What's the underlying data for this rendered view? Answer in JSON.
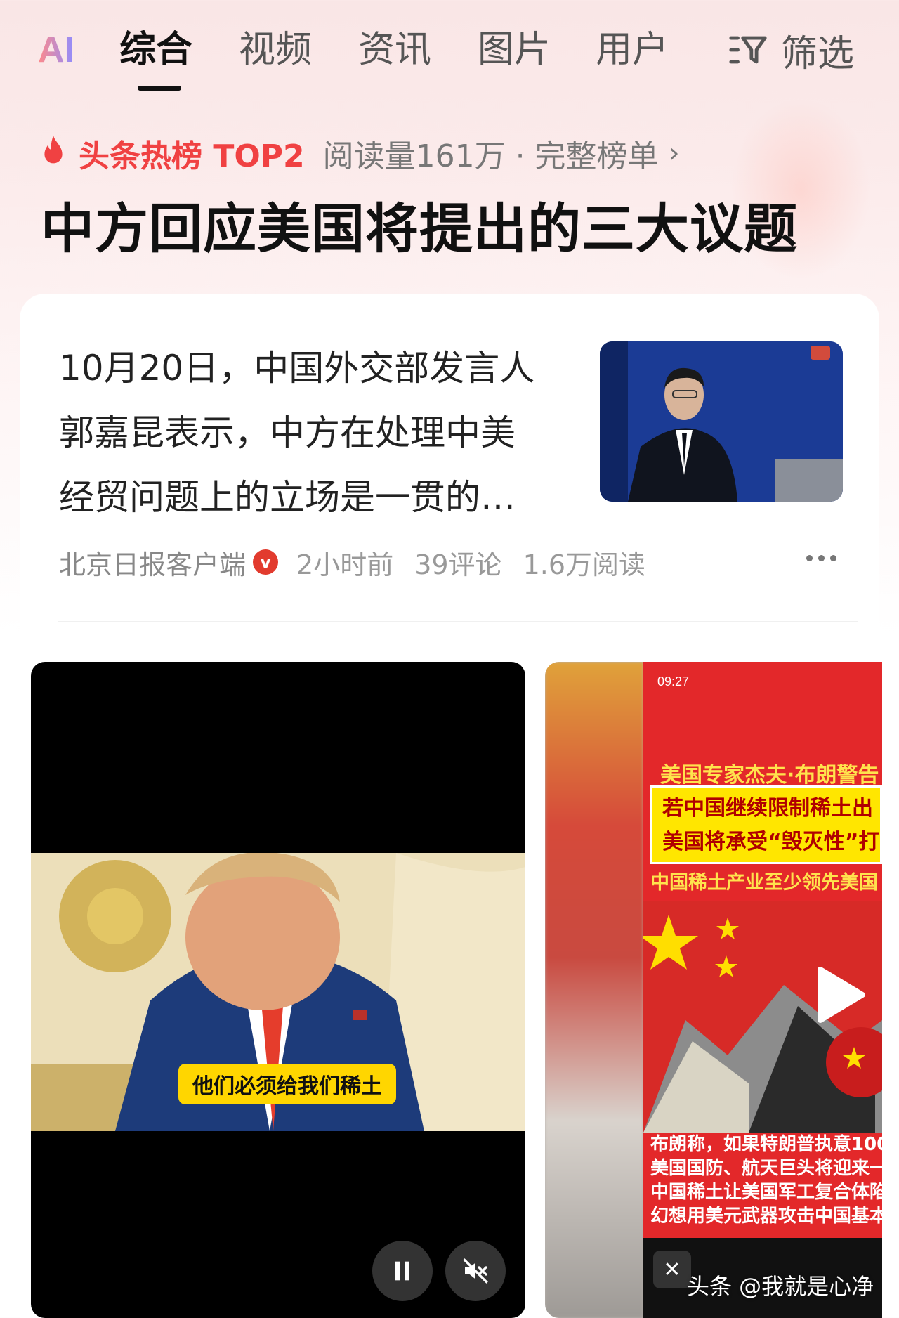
{
  "tabs": {
    "ai": "AI",
    "items": [
      {
        "label": "综合"
      },
      {
        "label": "视频"
      },
      {
        "label": "资讯"
      },
      {
        "label": "图片"
      },
      {
        "label": "用户"
      }
    ],
    "filter": "筛选"
  },
  "hot": {
    "brand": "头条热榜 TOP2",
    "meta": "阅读量161万 · 完整榜单",
    "chevron": "›"
  },
  "headline": "中方回应美国将提出的三大议题",
  "article": {
    "lines": [
      "10月20日，中国外交部发言人",
      "郭嘉昆表示，中方在处理中美",
      "经贸问题上的立场是一贯的…"
    ],
    "source": "北京日报客户端",
    "verified": "v",
    "time": "2小时前",
    "comments": "39评论",
    "reads": "1.6万阅读"
  },
  "video1": {
    "caption": "他们必须给我们稀土"
  },
  "video2": {
    "status_time": "09:27",
    "title1": "美国专家杰夫·布朗警告",
    "box_line1": "若中国继续限制稀土出",
    "box_line2": "美国将承受“毁灭性”打",
    "title2": "中国稀土产业至少领先美国",
    "text_lines": [
      "布朗称，如果特朗普执意100",
      "美国国防、航天巨头将迎来一",
      "中国稀土让美国军工复合体陷",
      "幻想用美元武器攻击中国基本"
    ],
    "close": "✕"
  },
  "watermark": "头条 @我就是心净",
  "colors": {
    "brand_red": "#f04142",
    "caption_yellow": "#ffd600"
  }
}
